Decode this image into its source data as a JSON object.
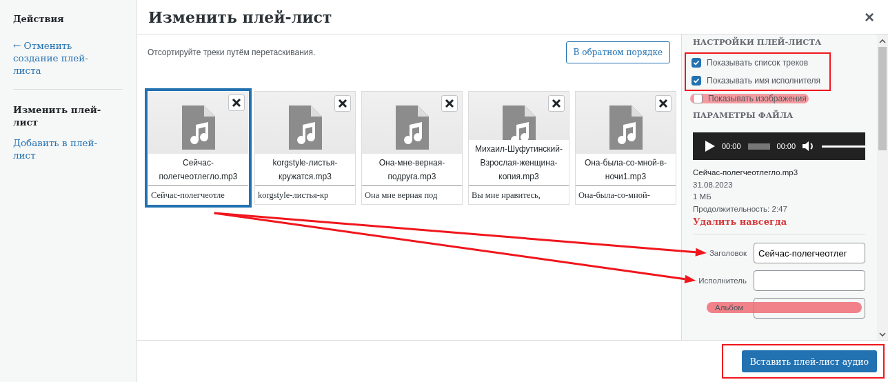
{
  "sidebar": {
    "title": "Действия",
    "items": [
      {
        "label": "← Отменить создание плей-листа",
        "kind": "link"
      },
      {
        "kind": "divider"
      },
      {
        "label": "Изменить плей-лист",
        "kind": "current"
      },
      {
        "label": "Добавить в плей-лист",
        "kind": "link"
      }
    ]
  },
  "modal": {
    "title": "Изменить плей-лист",
    "close": "×"
  },
  "hint": "Отсортируйте треки путём перетаскивания.",
  "reverse_button": "В обратном порядке",
  "tracks": [
    {
      "name": "Сейчас-полегчеотлегло.mp3",
      "caption": "Сейчас-полегчеотле",
      "selected": true
    },
    {
      "name": "korgstyle-листья-кружатся.mp3",
      "caption": "korgstyle-листья-кр",
      "selected": false
    },
    {
      "name": "Она-мне-верная-подруга.mp3",
      "caption": "Она мне верная под",
      "selected": false
    },
    {
      "name": "Михаил-Шуфутинский-Взрослая-женщина-копия.mp3",
      "caption": "Вы мне нравитесь,",
      "selected": false
    },
    {
      "name": "Она-была-со-мной-в-ночи1.mp3",
      "caption": "Она-была-со-мной-",
      "selected": false
    }
  ],
  "settings": {
    "heading": "НАСТРОЙКИ ПЛЕЙ-ЛИСТА",
    "options": [
      {
        "label": "Показывать список треков",
        "checked": true,
        "boxed": true
      },
      {
        "label": "Показывать имя исполнителя",
        "checked": true,
        "boxed": true
      },
      {
        "label": "Показывать изображения",
        "checked": false,
        "highlighted": true
      }
    ]
  },
  "file": {
    "heading": "ПАРАМЕТРЫ ФАЙЛА",
    "player": {
      "current": "00:00",
      "duration": "00:00"
    },
    "name": "Сейчас-полегчеотлегло.mp3",
    "date": "31.08.2023",
    "size": "1 МБ",
    "length": "Продолжительность: 2:47",
    "delete": "Удалить навсегда",
    "fields": [
      {
        "label": "Заголовок",
        "value": "Сейчас-полегчеотлег",
        "arrow": true
      },
      {
        "label": "Исполнитель",
        "arrow": true
      },
      {
        "label": "Альбом",
        "highlighted": true
      }
    ]
  },
  "footer": {
    "button": "Вставить плей-лист аудио",
    "boxed": true
  }
}
